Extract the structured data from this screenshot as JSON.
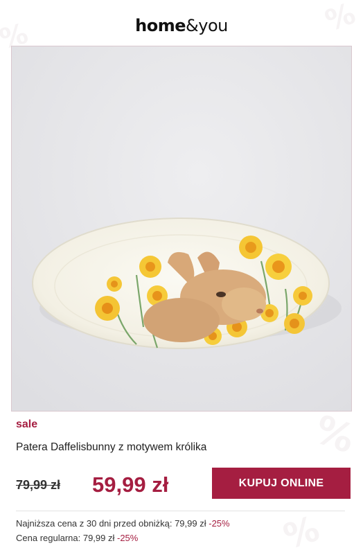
{
  "header": {
    "logo_part1": "home",
    "logo_part2": "&",
    "logo_part3": "you"
  },
  "product": {
    "image_alt": "Patera Daffelisbunny z motywem królika",
    "sale_label": "sale",
    "name": "Patera Daffelisbunny z motywem królika",
    "old_price": "79,99 zł",
    "new_price": "59,99 zł",
    "buy_button_label": "KUPUJ ONLINE"
  },
  "info": {
    "lowest_price_text": "Najniższa cena z 30 dni przed obniżką: 79,99 zł",
    "lowest_price_discount": "-25%",
    "regular_price_text": "Cena regularna: 79,99 zł",
    "regular_price_discount": "-25%"
  },
  "colors": {
    "accent": "#a51e41",
    "image_background": "#e8e8ea"
  },
  "icons": [
    "percent-watermark-icon"
  ]
}
